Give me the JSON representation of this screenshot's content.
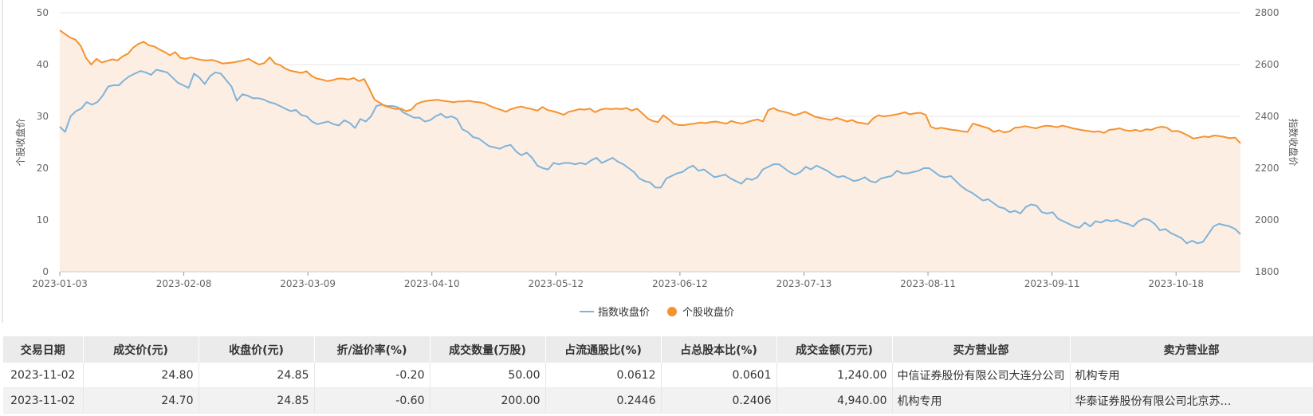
{
  "chart_data": {
    "type": "line",
    "x_tick_labels": [
      "2023-01-03",
      "2023-02-08",
      "2023-03-09",
      "2023-04-10",
      "2023-05-12",
      "2023-06-12",
      "2023-07-13",
      "2023-08-11",
      "2023-09-11",
      "2023-10-18"
    ],
    "y_left": {
      "label": "个股收盘价",
      "range": [
        0,
        50
      ],
      "ticks": [
        0,
        10,
        20,
        30,
        40,
        50
      ]
    },
    "y_right": {
      "label": "指数收盘价",
      "range": [
        1800,
        2800
      ],
      "ticks": [
        1800,
        2000,
        2200,
        2400,
        2600,
        2800
      ]
    },
    "grid": true,
    "legend_position": "bottom-center",
    "series": [
      {
        "name": "指数收盘价",
        "axis": "right",
        "color": "#7fb3d9",
        "values": [
          2360,
          2340,
          2400,
          2420,
          2430,
          2455,
          2445,
          2455,
          2480,
          2515,
          2520,
          2520,
          2540,
          2555,
          2565,
          2575,
          2570,
          2560,
          2580,
          2575,
          2570,
          2550,
          2530,
          2520,
          2510,
          2565,
          2550,
          2525,
          2555,
          2570,
          2565,
          2540,
          2515,
          2460,
          2485,
          2480,
          2470,
          2470,
          2465,
          2455,
          2450,
          2440,
          2430,
          2420,
          2425,
          2405,
          2400,
          2380,
          2370,
          2375,
          2380,
          2370,
          2365,
          2385,
          2375,
          2355,
          2390,
          2380,
          2400,
          2440,
          2445,
          2440,
          2440,
          2435,
          2415,
          2405,
          2395,
          2395,
          2380,
          2385,
          2400,
          2410,
          2395,
          2400,
          2390,
          2350,
          2340,
          2320,
          2315,
          2300,
          2285,
          2280,
          2275,
          2285,
          2290,
          2265,
          2250,
          2260,
          2240,
          2210,
          2200,
          2195,
          2220,
          2215,
          2220,
          2220,
          2215,
          2220,
          2215,
          2230,
          2240,
          2220,
          2230,
          2240,
          2225,
          2215,
          2200,
          2185,
          2160,
          2150,
          2145,
          2125,
          2125,
          2160,
          2170,
          2180,
          2185,
          2200,
          2210,
          2190,
          2195,
          2180,
          2165,
          2170,
          2175,
          2160,
          2150,
          2140,
          2160,
          2155,
          2165,
          2195,
          2205,
          2215,
          2215,
          2200,
          2185,
          2175,
          2185,
          2205,
          2195,
          2210,
          2200,
          2190,
          2175,
          2165,
          2170,
          2160,
          2150,
          2155,
          2165,
          2150,
          2145,
          2160,
          2165,
          2170,
          2190,
          2180,
          2180,
          2185,
          2190,
          2200,
          2200,
          2185,
          2170,
          2165,
          2170,
          2150,
          2130,
          2115,
          2105,
          2090,
          2075,
          2080,
          2065,
          2050,
          2045,
          2030,
          2035,
          2025,
          2050,
          2060,
          2055,
          2030,
          2025,
          2030,
          2005,
          1995,
          1985,
          1975,
          1970,
          1990,
          1975,
          1995,
          1990,
          2000,
          1995,
          2000,
          1990,
          1985,
          1975,
          1995,
          2005,
          2000,
          1985,
          1960,
          1965,
          1950,
          1940,
          1930,
          1910,
          1920,
          1910,
          1915,
          1945,
          1975,
          1985,
          1980,
          1975,
          1965,
          1945
        ]
      },
      {
        "name": "个股收盘价",
        "axis": "left",
        "color": "#f5922e",
        "values": [
          46.6,
          45.9,
          45.2,
          44.8,
          43.6,
          41.3,
          40.0,
          41.1,
          40.4,
          40.7,
          41.0,
          40.8,
          41.6,
          42.1,
          43.3,
          44.0,
          44.4,
          43.7,
          43.5,
          42.9,
          42.4,
          41.8,
          42.4,
          41.3,
          41.1,
          41.4,
          41.1,
          40.9,
          40.8,
          40.9,
          40.6,
          40.2,
          40.3,
          40.4,
          40.6,
          40.8,
          41.1,
          40.5,
          40.0,
          40.3,
          41.4,
          40.2,
          39.9,
          39.2,
          38.8,
          38.6,
          38.4,
          38.7,
          37.8,
          37.3,
          37.1,
          36.8,
          37.0,
          37.3,
          37.3,
          37.1,
          37.4,
          36.8,
          37.2,
          35.3,
          33.2,
          32.6,
          32.0,
          31.7,
          31.4,
          31.5,
          31.0,
          31.3,
          32.4,
          32.8,
          33.0,
          33.1,
          33.2,
          33.0,
          32.9,
          32.7,
          32.9,
          32.9,
          33.0,
          32.8,
          32.7,
          32.5,
          32.0,
          31.6,
          31.3,
          30.9,
          31.4,
          31.7,
          31.9,
          31.6,
          31.4,
          31.1,
          31.8,
          31.2,
          31.0,
          30.7,
          30.3,
          30.9,
          31.1,
          31.4,
          31.3,
          31.5,
          30.8,
          31.3,
          31.5,
          31.4,
          31.5,
          31.4,
          31.6,
          31.1,
          31.5,
          30.6,
          29.6,
          29.1,
          28.9,
          30.2,
          29.5,
          28.6,
          28.3,
          28.3,
          28.5,
          28.6,
          28.8,
          28.7,
          28.9,
          29.0,
          28.8,
          28.6,
          29.1,
          28.8,
          28.6,
          28.9,
          29.2,
          29.4,
          29.0,
          31.2,
          31.6,
          31.1,
          30.9,
          30.6,
          30.2,
          30.5,
          30.9,
          30.4,
          29.9,
          29.7,
          29.5,
          29.3,
          29.7,
          29.4,
          29.0,
          29.3,
          28.8,
          28.7,
          28.5,
          29.6,
          30.2,
          30.0,
          30.1,
          30.3,
          30.5,
          30.8,
          30.4,
          30.6,
          30.7,
          30.3,
          28.0,
          27.6,
          27.8,
          27.6,
          27.4,
          27.3,
          27.1,
          27.0,
          28.6,
          28.3,
          28.0,
          27.7,
          27.0,
          27.3,
          26.9,
          27.1,
          27.8,
          27.9,
          28.1,
          27.9,
          27.7,
          28.0,
          28.2,
          28.1,
          27.9,
          28.2,
          28.0,
          27.7,
          27.5,
          27.3,
          27.2,
          27.0,
          27.1,
          26.8,
          27.4,
          27.5,
          27.7,
          27.3,
          27.2,
          27.4,
          27.1,
          27.5,
          27.4,
          27.8,
          28.0,
          27.8,
          27.1,
          27.2,
          26.8,
          26.3,
          25.7,
          25.9,
          26.1,
          26.0,
          26.3,
          26.2,
          26.0,
          25.8,
          25.9,
          24.8
        ]
      }
    ]
  },
  "legend": {
    "items": [
      {
        "label": "指数收盘价",
        "color": "#7fb3d9",
        "symbol": "line"
      },
      {
        "label": "个股收盘价",
        "color": "#f5922e",
        "symbol": "dot"
      }
    ]
  },
  "table": {
    "headers": [
      "交易日期",
      "成交价(元)",
      "收盘价(元)",
      "折/溢价率(%)",
      "成交数量(万股)",
      "占流通股比(%)",
      "占总股本比(%)",
      "成交金额(万元)",
      "买方营业部",
      "卖方营业部"
    ],
    "rows": [
      [
        "2023-11-02",
        "24.80",
        "24.85",
        "-0.20",
        "50.00",
        "0.0612",
        "0.0601",
        "1,240.00",
        "中信证券股份有限公司大连分公司",
        "机构专用"
      ],
      [
        "2023-11-02",
        "24.70",
        "24.85",
        "-0.60",
        "200.00",
        "0.2446",
        "0.2406",
        "4,940.00",
        "机构专用",
        "华泰证券股份有限公司北京苏…"
      ]
    ]
  },
  "colors": {
    "area_fill": "#fdeee3",
    "grid": "#e6e6e6",
    "axis": "#cccccc"
  }
}
